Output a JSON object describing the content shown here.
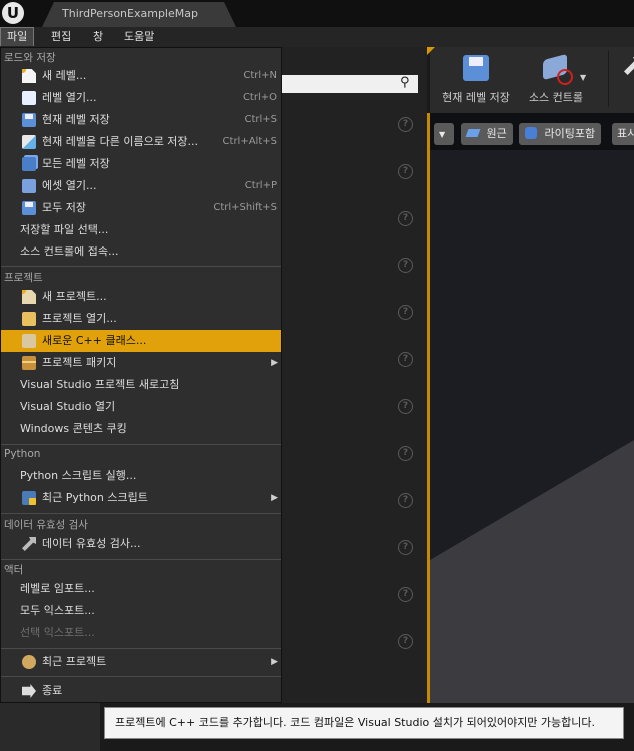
{
  "window": {
    "tab_title": "ThirdPersonExampleMap",
    "logo_icon": "unreal-logo-icon"
  },
  "menubar": {
    "items": [
      "파일",
      "편집",
      "창",
      "도움말"
    ],
    "active": "파일"
  },
  "toolbar": {
    "save_level_label": "현재 레벨 저장",
    "source_control_label": "소스 컨트롤"
  },
  "viewport": {
    "perspective_label": "원근",
    "lighting_label": "라이팅포함",
    "show_label": "표시"
  },
  "menu": {
    "sections": {
      "load_save": "로드와 저장",
      "project": "프로젝트",
      "python": "Python",
      "data_validation": "데이터 유효성 검사",
      "actor": "액터"
    },
    "items": {
      "new_level": {
        "label": "새 레벨...",
        "shortcut": "Ctrl+N"
      },
      "open_level": {
        "label": "레벨 열기...",
        "shortcut": "Ctrl+O"
      },
      "save_current": {
        "label": "현재 레벨 저장",
        "shortcut": "Ctrl+S"
      },
      "save_as": {
        "label": "현재 레벨을 다른 이름으로 저장...",
        "shortcut": "Ctrl+Alt+S"
      },
      "save_all_levels": {
        "label": "모든 레벨 저장"
      },
      "open_asset": {
        "label": "에셋 열기...",
        "shortcut": "Ctrl+P"
      },
      "save_all": {
        "label": "모두 저장",
        "shortcut": "Ctrl+Shift+S"
      },
      "choose_files": {
        "label": "저장할 파일 선택..."
      },
      "source_control": {
        "label": "소스 컨트롤에 접속..."
      },
      "new_project": {
        "label": "새 프로젝트..."
      },
      "open_project": {
        "label": "프로젝트 열기..."
      },
      "new_cpp_class": {
        "label": "새로운 C++ 클래스..."
      },
      "package_project": {
        "label": "프로젝트 패키지"
      },
      "refresh_vs": {
        "label": "Visual Studio 프로젝트 새로고침"
      },
      "open_vs": {
        "label": "Visual Studio 열기"
      },
      "cook_windows": {
        "label": "Windows 콘텐츠 쿠킹"
      },
      "run_python": {
        "label": "Python 스크립트 실행..."
      },
      "recent_python": {
        "label": "최근 Python 스크립트"
      },
      "validate_data": {
        "label": "데이터 유효성 검사..."
      },
      "import_level": {
        "label": "레벨로 임포트..."
      },
      "export_all": {
        "label": "모두 익스포트..."
      },
      "export_selected": {
        "label": "선택 익스포트..."
      },
      "recent_projects": {
        "label": "최근 프로젝트"
      },
      "exit": {
        "label": "종료"
      }
    }
  },
  "tooltip": {
    "text": "프로젝트에 C++ 코드를 추가합니다. 코드 컴파일은 Visual Studio 설치가 되어있어야지만 가능합니다."
  },
  "colors": {
    "highlight": "#e0a10a",
    "viewport_border": "#c68a00"
  }
}
